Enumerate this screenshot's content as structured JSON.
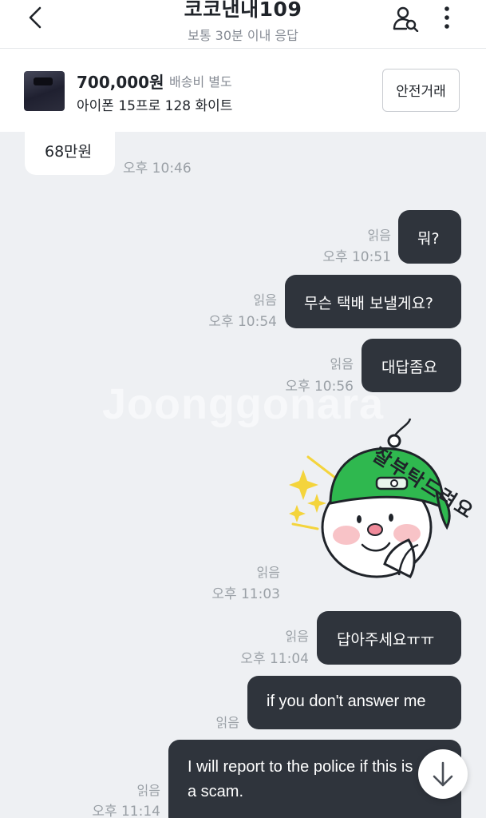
{
  "header": {
    "title": "코코낸내109",
    "subtitle": "보통 30분 이내 응답",
    "back_icon": "chevron-left-icon",
    "profile_icon": "user-search-icon",
    "more_icon": "more-vertical-icon"
  },
  "product": {
    "price": "700,000원",
    "shipping": "배송비 별도",
    "name": "아이폰 15프로 128 화이트",
    "safe_trade_label": "안전거래"
  },
  "watermark": "Joonggonara",
  "messages": [
    {
      "side": "in",
      "text": "68만원",
      "time": "오후 10:46"
    },
    {
      "side": "out",
      "text": "뭐?",
      "read": "읽음",
      "time": "오후 10:51"
    },
    {
      "side": "out",
      "text": "무슨 택배 보낼게요?",
      "read": "읽음",
      "time": "오후 10:54"
    },
    {
      "side": "out",
      "text": "대답좀요",
      "read": "읽음",
      "time": "오후 10:56"
    },
    {
      "side": "out",
      "type": "sticker",
      "sticker_text": "잘부탁드려요",
      "read": "읽음",
      "time": "오후 11:03"
    },
    {
      "side": "out",
      "text": "답아주세요ㅠㅠ",
      "read": "읽음",
      "time": "오후 11:04"
    },
    {
      "side": "out",
      "text": "if you don't answer me",
      "read": "읽음",
      "time": ""
    },
    {
      "side": "out",
      "text_line1": "I will report to the police if this is",
      "text_line2": "a scam.",
      "read": "읽음",
      "time": "오후 11:14"
    }
  ],
  "scroll_down_icon": "arrow-down-icon",
  "colors": {
    "outgoing_bubble": "#2f343c",
    "incoming_bubble": "#ffffff",
    "chat_background": "#eef0f3",
    "sticker_cap": "#2fb84f"
  }
}
